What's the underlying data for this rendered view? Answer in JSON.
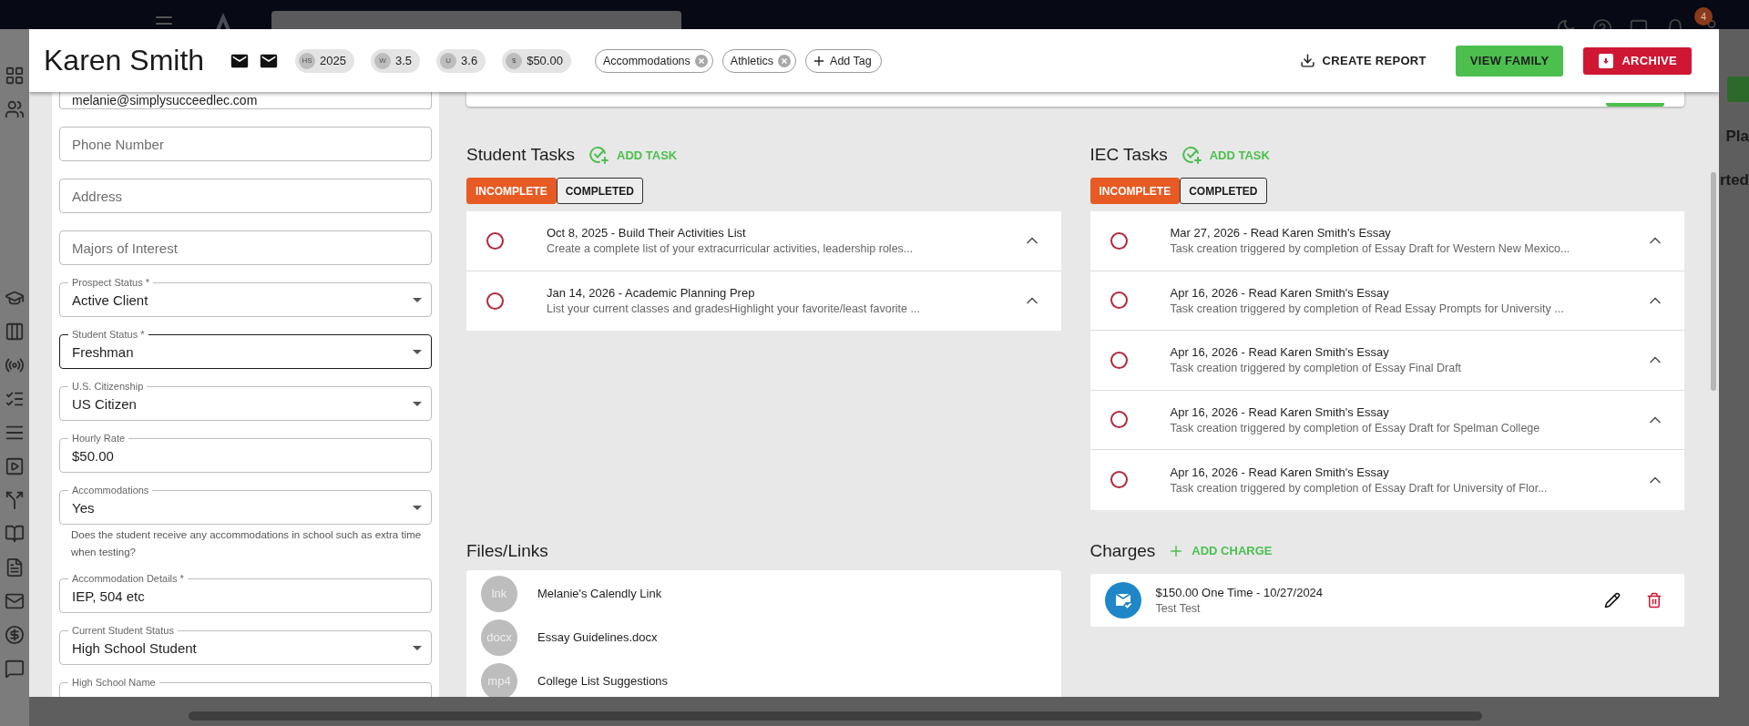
{
  "topbar": {
    "notification_count": "4"
  },
  "background": {
    "fragments": [
      "Pla",
      "rted"
    ]
  },
  "profile": {
    "name": "Karen Smith",
    "stats": [
      {
        "abbr": "HS",
        "value": "2025"
      },
      {
        "abbr": "W",
        "value": "3.5"
      },
      {
        "abbr": "U",
        "value": "3.6"
      },
      {
        "abbr": "$",
        "value": "$50.00"
      }
    ],
    "tags": [
      {
        "label": "Accommodations"
      },
      {
        "label": "Athletics"
      }
    ],
    "add_tag": "Add Tag",
    "actions": [
      {
        "label": "CREATE REPORT",
        "kind": "text"
      },
      {
        "label": "VIEW FAMILY",
        "kind": "success"
      },
      {
        "label": "ARCHIVE",
        "kind": "danger"
      }
    ]
  },
  "form": {
    "fields": [
      {
        "kind": "partial",
        "value": "melanie@simplysucceedlec.com",
        "focused": false
      },
      {
        "kind": "text",
        "placeholder": "Phone Number",
        "focused": false
      },
      {
        "kind": "text",
        "placeholder": "Address",
        "focused": false
      },
      {
        "kind": "text",
        "placeholder": "Majors of Interest",
        "focused": false
      },
      {
        "kind": "select",
        "label": "Prospect Status *",
        "value": "Active Client",
        "focused": false
      },
      {
        "kind": "select",
        "label": "Student Status *",
        "value": "Freshman",
        "focused": true
      },
      {
        "kind": "select",
        "label": "U.S. Citizenship",
        "value": "US Citizen",
        "focused": false
      },
      {
        "kind": "text",
        "label": "Hourly Rate",
        "value": "$50.00",
        "focused": false
      },
      {
        "kind": "select",
        "label": "Accommodations",
        "value": "Yes",
        "helper": "Does the student receive any accommodations in school such as extra time when testing?",
        "focused": false
      },
      {
        "kind": "text",
        "label": "Accommodation Details *",
        "value": "IEP, 504 etc",
        "focused": false
      },
      {
        "kind": "select",
        "label": "Current Student Status",
        "value": "High School Student",
        "focused": false
      },
      {
        "kind": "text",
        "label": "High School Name",
        "focused": false
      }
    ]
  },
  "student_tasks": {
    "title": "Student Tasks",
    "add_label": "ADD TASK",
    "filters": [
      {
        "label": "INCOMPLETE",
        "selected": true
      },
      {
        "label": "COMPLETED",
        "selected": false
      }
    ],
    "items": [
      {
        "title": "Oct 8, 2025 - Build Their Activities List",
        "summary": "Create a complete list of your extracurricular activities, leadership roles...",
        "checked": false
      },
      {
        "title": "Jan 14, 2026 - Academic Planning Prep",
        "summary": "List your current classes and gradesHighlight your favorite/least favorite ...",
        "checked": false
      }
    ]
  },
  "iec_tasks": {
    "title": "IEC Tasks",
    "add_label": "ADD TASK",
    "filters": [
      {
        "label": "INCOMPLETE",
        "selected": true
      },
      {
        "label": "COMPLETED",
        "selected": false
      }
    ],
    "items": [
      {
        "title": "Mar 27, 2026 - Read Karen Smith's Essay",
        "summary": "Task creation triggered by completion of Essay Draft for Western New Mexico...",
        "checked": false
      },
      {
        "title": "Apr 16, 2026 - Read Karen Smith's Essay",
        "summary": "Task creation triggered by completion of Read Essay Prompts for University ...",
        "checked": false
      },
      {
        "title": "Apr 16, 2026 - Read Karen Smith's Essay",
        "summary": "Task creation triggered by completion of Essay Final Draft",
        "checked": false
      },
      {
        "title": "Apr 16, 2026 - Read Karen Smith's Essay",
        "summary": "Task creation triggered by completion of Essay Draft for Spelman College",
        "checked": false
      },
      {
        "title": "Apr 16, 2026 - Read Karen Smith's Essay",
        "summary": "Task creation triggered by completion of Essay Draft for University of Flor...",
        "checked": false
      }
    ]
  },
  "files": {
    "title": "Files/Links",
    "items": [
      {
        "badge": "lnk",
        "name": "Melanie's Calendly Link"
      },
      {
        "badge": "docx",
        "name": "Essay Guidelines.docx"
      },
      {
        "badge": "mp4",
        "name": "College List Suggestions"
      }
    ]
  },
  "charges": {
    "title": "Charges",
    "add_label": "ADD CHARGE",
    "items": [
      {
        "title": "$150.00 One Time - 10/27/2024",
        "subtitle": "Test Test"
      }
    ]
  }
}
